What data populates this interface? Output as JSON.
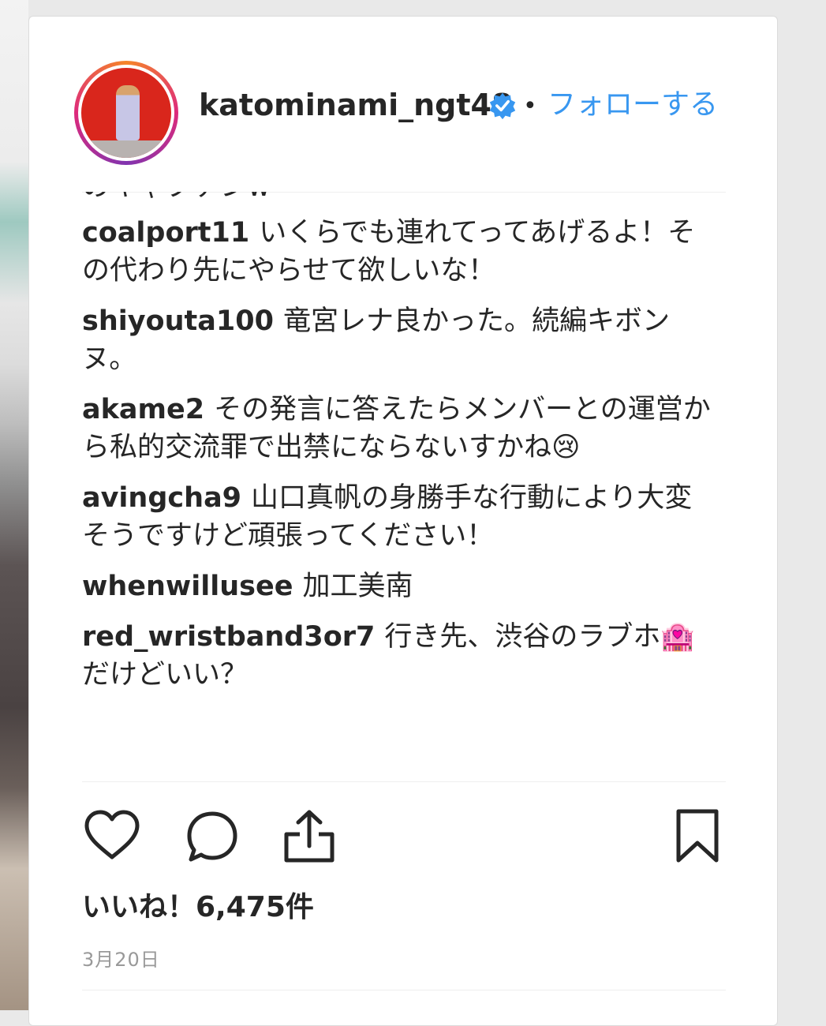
{
  "post": {
    "username": "katominami_ngt48",
    "separator": "•",
    "follow_label": "フォローする"
  },
  "comments": {
    "cut_text": "のキャプテンw",
    "items": [
      {
        "user": "coalport11",
        "text": "いくらでも連れてってあげるよ！その代わり先にやらせて欲しいな！"
      },
      {
        "user": "shiyouta100",
        "text": "竜宮レナ良かった。続編キボンヌ。"
      },
      {
        "user": "akame2",
        "text": "その発言に答えたらメンバーとの運営から私的交流罪で出禁にならないすかね😢"
      },
      {
        "user": "avingcha9",
        "text": "山口真帆の身勝手な行動により大変そうですけど頑張ってください！"
      },
      {
        "user": "whenwillusee",
        "text": "加工美南"
      },
      {
        "user": "red_wristband3or7",
        "text": "行き先、渋谷のラブホ🏩だけどいい？"
      }
    ]
  },
  "actions": {
    "like_icon": "heart-icon",
    "comment_icon": "comment-bubble-icon",
    "share_icon": "share-icon",
    "save_icon": "bookmark-icon"
  },
  "likes_label": "いいね！6,475件",
  "date_label": "3月20日",
  "colors": {
    "link": "#3897f0",
    "text": "#262626",
    "muted": "#999999",
    "verified": "#3897f0"
  }
}
